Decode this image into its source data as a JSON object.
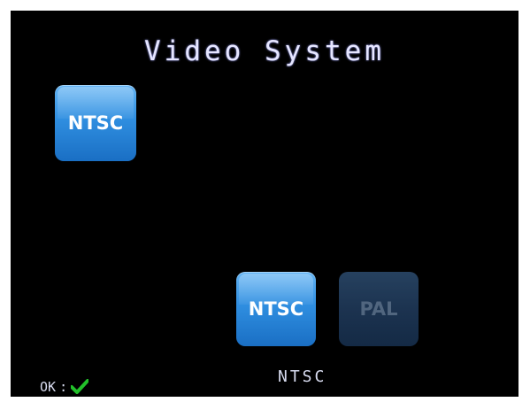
{
  "screen": {
    "title": "Video System"
  },
  "current": {
    "label": "NTSC"
  },
  "options": [
    {
      "label": "NTSC",
      "selected": true
    },
    {
      "label": "PAL",
      "selected": false
    }
  ],
  "selected_text": "NTSC",
  "hint": {
    "key": "OK",
    "separator": ":",
    "icon": "check-icon"
  },
  "colors": {
    "background": "#000000",
    "active_tile": "#2f8ee0",
    "inactive_tile": "#1c3350",
    "check": "#22c02a"
  }
}
